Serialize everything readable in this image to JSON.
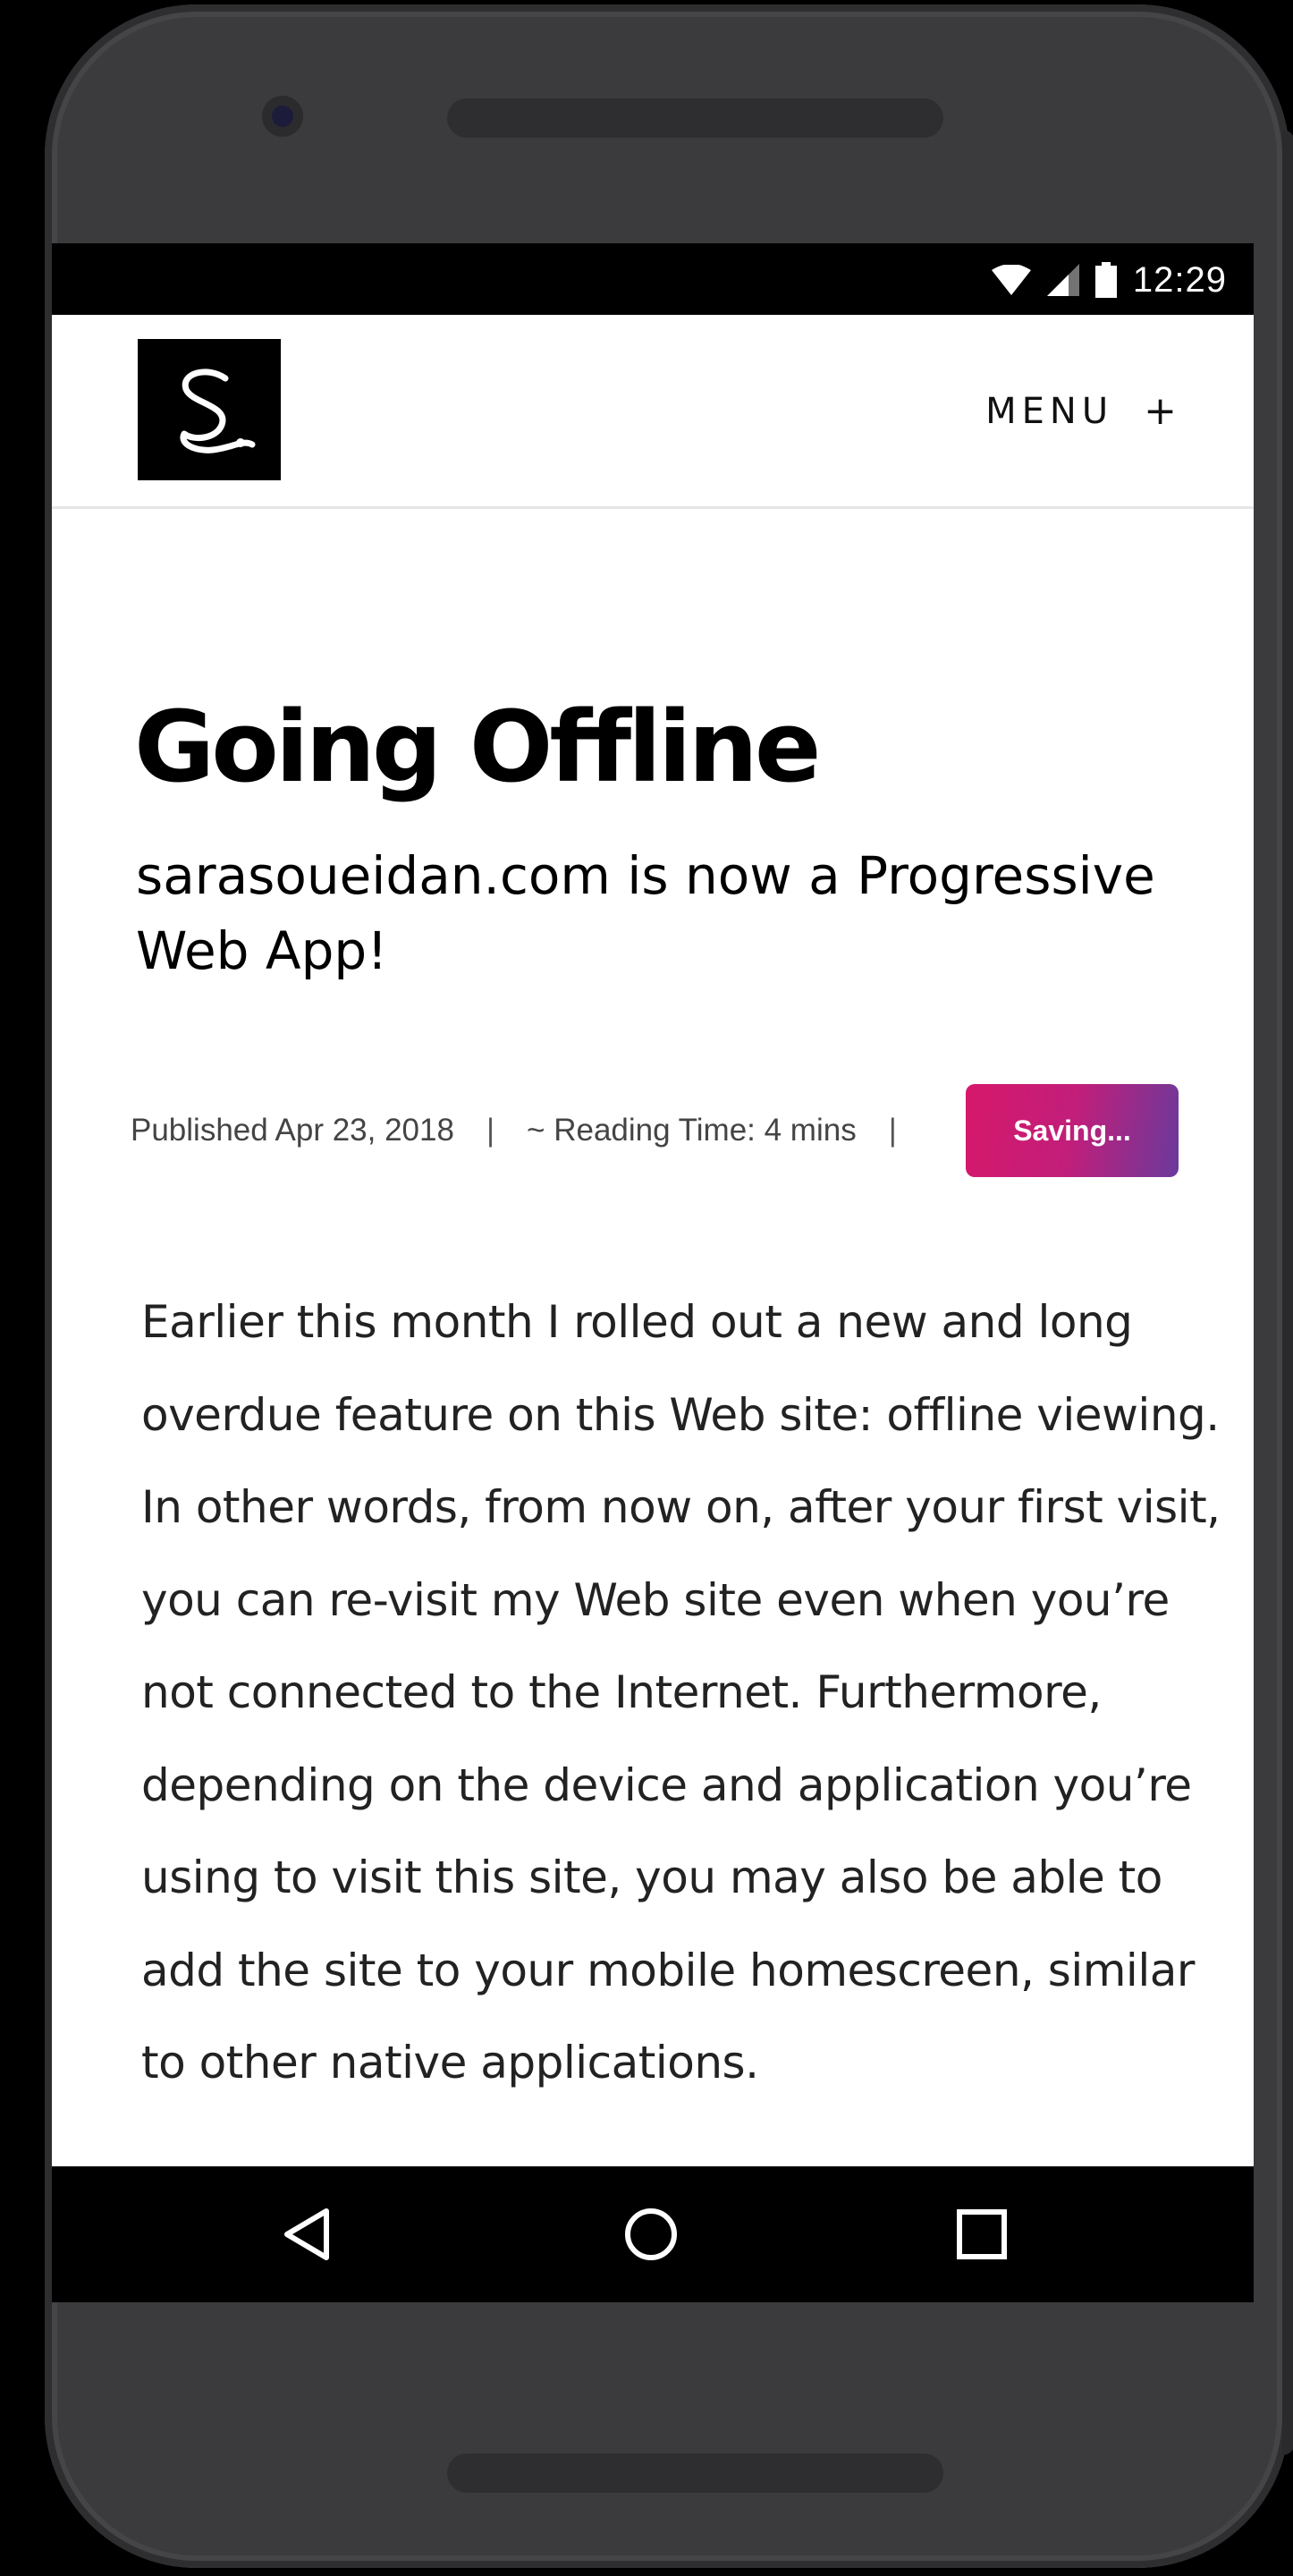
{
  "status_bar": {
    "time": "12:29",
    "icons": [
      "wifi-icon",
      "signal-icon",
      "battery-icon"
    ]
  },
  "header": {
    "logo_text": "S.",
    "menu_label": "MENU",
    "menu_icon": "+"
  },
  "article": {
    "title": "Going Offline",
    "subtitle": "sarasoueidan.com is now a Progressive Web App!",
    "published": "Published Apr 23, 2018",
    "separator": "|",
    "reading_time": "~ Reading Time: 4 mins",
    "save_button_label": "Saving...",
    "body": "Earlier this month I rolled out a new and long overdue feature on this Web site: offline viewing. In other words, from now on, after your first visit, you can re-visit my Web site even when you’re not connected to the Internet. Furthermore, depending on the device and application you’re using to visit this site, you may also be able to add the site to your mobile homescreen, similar to other native applications."
  },
  "nav": {
    "buttons": [
      "back-icon",
      "home-icon",
      "recents-icon"
    ]
  },
  "colors": {
    "button_gradient_start": "#d6186b",
    "button_gradient_end": "#6a3a9c",
    "status_bar": "#000000",
    "phone_frame": "#3b3b3d"
  }
}
